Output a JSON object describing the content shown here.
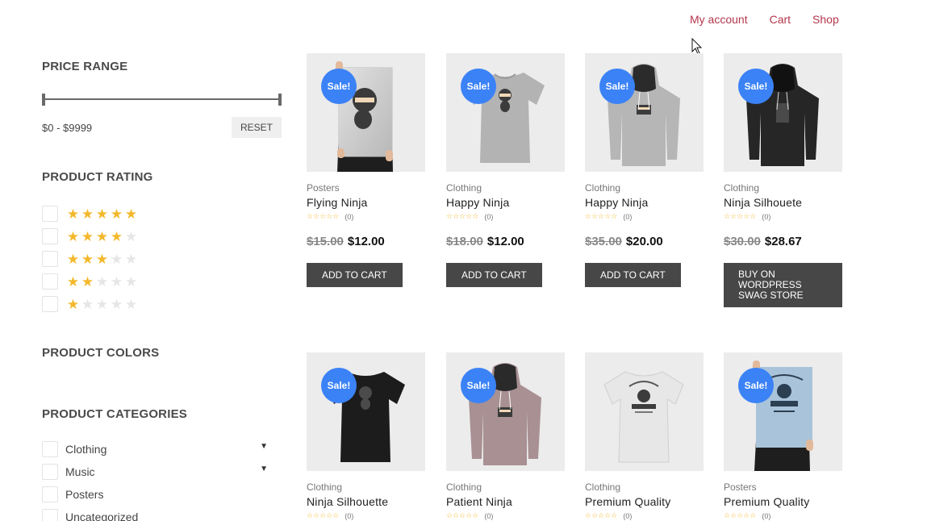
{
  "nav": {
    "items": [
      "My account",
      "Cart",
      "Shop"
    ]
  },
  "sidebar": {
    "price_range": {
      "title": "PRICE RANGE",
      "values": "$0 - $9999",
      "reset_label": "RESET"
    },
    "product_rating": {
      "title": "PRODUCT RATING",
      "rows": [
        5,
        4,
        3,
        2,
        1
      ]
    },
    "product_colors": {
      "title": "PRODUCT COLORS"
    },
    "product_categories": {
      "title": "PRODUCT CATEGORIES",
      "items": [
        {
          "label": "Clothing",
          "expandable": true
        },
        {
          "label": "Music",
          "expandable": true
        },
        {
          "label": "Posters",
          "expandable": false
        },
        {
          "label": "Uncategorized",
          "expandable": false
        }
      ]
    }
  },
  "products": [
    {
      "badge": "Sale!",
      "category": "Posters",
      "title": "Flying Ninja",
      "rating_count": "(0)",
      "old_price": "$15.00",
      "price": "$12.00",
      "button": "ADD TO CART",
      "art": "poster-ninja"
    },
    {
      "badge": "Sale!",
      "category": "Clothing",
      "title": "Happy Ninja",
      "rating_count": "(0)",
      "old_price": "$18.00",
      "price": "$12.00",
      "button": "ADD TO CART",
      "art": "tshirt-grey"
    },
    {
      "badge": "Sale!",
      "category": "Clothing",
      "title": "Happy Ninja",
      "rating_count": "(0)",
      "old_price": "$35.00",
      "price": "$20.00",
      "button": "ADD TO CART",
      "art": "hoodie-grey"
    },
    {
      "badge": "Sale!",
      "category": "Clothing",
      "title": "Ninja Silhouete",
      "rating_count": "(0)",
      "old_price": "$30.00",
      "price": "$28.67",
      "button": "BUY ON WORDPRESS SWAG STORE",
      "art": "hoodie-black"
    },
    {
      "badge": "Sale!",
      "category": "Clothing",
      "title": "Ninja Silhouette",
      "rating_count": "(0)",
      "art": "tshirt-black"
    },
    {
      "badge": "Sale!",
      "category": "Clothing",
      "title": "Patient Ninja",
      "rating_count": "(0)",
      "art": "hoodie-mauve"
    },
    {
      "category": "Clothing",
      "title": "Premium Quality",
      "rating_count": "(0)",
      "art": "tshirt-white"
    },
    {
      "badge": "Sale!",
      "category": "Posters",
      "title": "Premium Quality",
      "rating_count": "(0)",
      "art": "poster-blue"
    }
  ],
  "colors": {
    "accent_link": "#b5374c",
    "sale_badge": "#3b82f6",
    "star": "#f3b82b",
    "button": "#474747"
  }
}
